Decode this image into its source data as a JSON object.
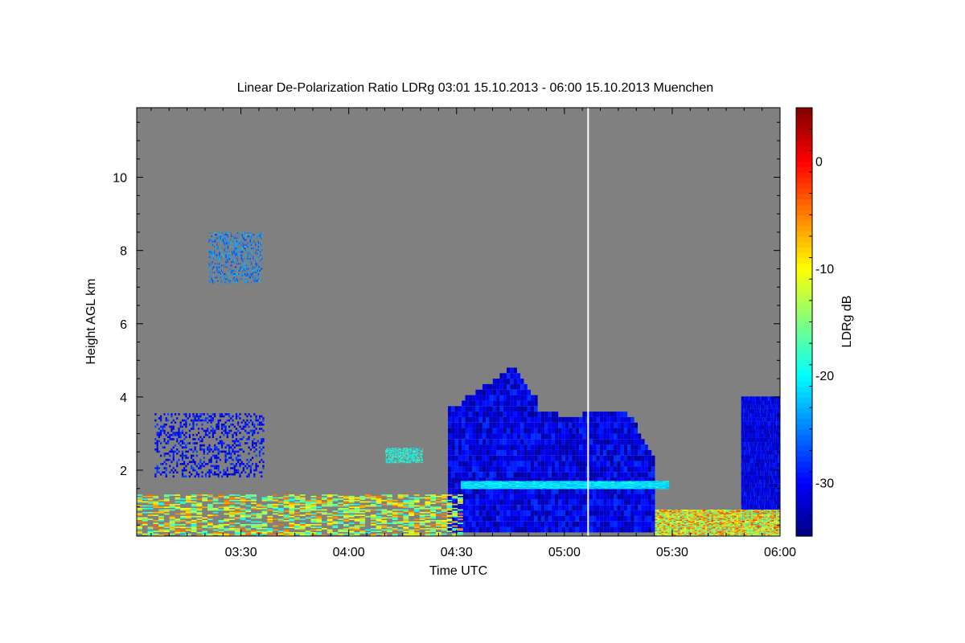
{
  "chart_data": {
    "type": "heatmap",
    "title": "Linear De-Polarization Ratio LDRg   03:01 15.10.2013 - 06:00 15.10.2013 Muenchen",
    "xlabel": "Time UTC",
    "ylabel": "Height AGL km",
    "colorbar_label": "LDRg dB",
    "x_start": "03:01",
    "x_end": "06:00",
    "xlim_hours": [
      3.0167,
      6.0
    ],
    "ylim": [
      0.2,
      11.9
    ],
    "x_ticks": [
      {
        "value": 3.5,
        "label": "03:30"
      },
      {
        "value": 4.0,
        "label": "04:00"
      },
      {
        "value": 4.5,
        "label": "04:30"
      },
      {
        "value": 5.0,
        "label": "05:00"
      },
      {
        "value": 5.5,
        "label": "05:30"
      },
      {
        "value": 6.0,
        "label": "06:00"
      }
    ],
    "y_ticks": [
      {
        "value": 2,
        "label": "2"
      },
      {
        "value": 4,
        "label": "4"
      },
      {
        "value": 6,
        "label": "6"
      },
      {
        "value": 8,
        "label": "8"
      },
      {
        "value": 10,
        "label": "10"
      }
    ],
    "colorbar": {
      "range": [
        -35,
        5
      ],
      "ticks": [
        {
          "value": 0,
          "label": "0"
        },
        {
          "value": -10,
          "label": "-10"
        },
        {
          "value": -20,
          "label": "-20"
        },
        {
          "value": -30,
          "label": "-30"
        }
      ],
      "colormap": "jet"
    },
    "background_color": "#808080",
    "missing_data_time": 5.11,
    "regions": [
      {
        "desc": "upper cirrus",
        "t0": 3.35,
        "t1": 3.6,
        "h0": 7.1,
        "h1": 8.5,
        "value": -25
      },
      {
        "desc": "isolated high cells",
        "t0": 3.1,
        "t1": 3.6,
        "h0": 1.8,
        "h1": 3.5,
        "value": -30
      },
      {
        "desc": "mid-level cell",
        "t0": 4.17,
        "t1": 4.34,
        "h0": 2.2,
        "h1": 2.6,
        "value": -19
      },
      {
        "desc": "main cloud body",
        "t0": 4.46,
        "t1": 5.42,
        "h0": 0.3,
        "h1": 4.8,
        "value": -31
      },
      {
        "desc": "melting layer",
        "t0": 4.52,
        "t1": 5.47,
        "h0": 1.5,
        "h1": 1.7,
        "value": -21
      },
      {
        "desc": "late cloud",
        "t0": 5.82,
        "t1": 6.0,
        "h0": 0.5,
        "h1": 3.9,
        "value": -31
      },
      {
        "desc": "boundary layer aerosol",
        "t0": 3.017,
        "t1": 4.53,
        "h0": 0.2,
        "h1": 1.3,
        "value": -12
      },
      {
        "desc": "surface layer",
        "t0": 5.42,
        "t1": 6.0,
        "h0": 0.2,
        "h1": 0.9,
        "value": -10
      }
    ]
  }
}
